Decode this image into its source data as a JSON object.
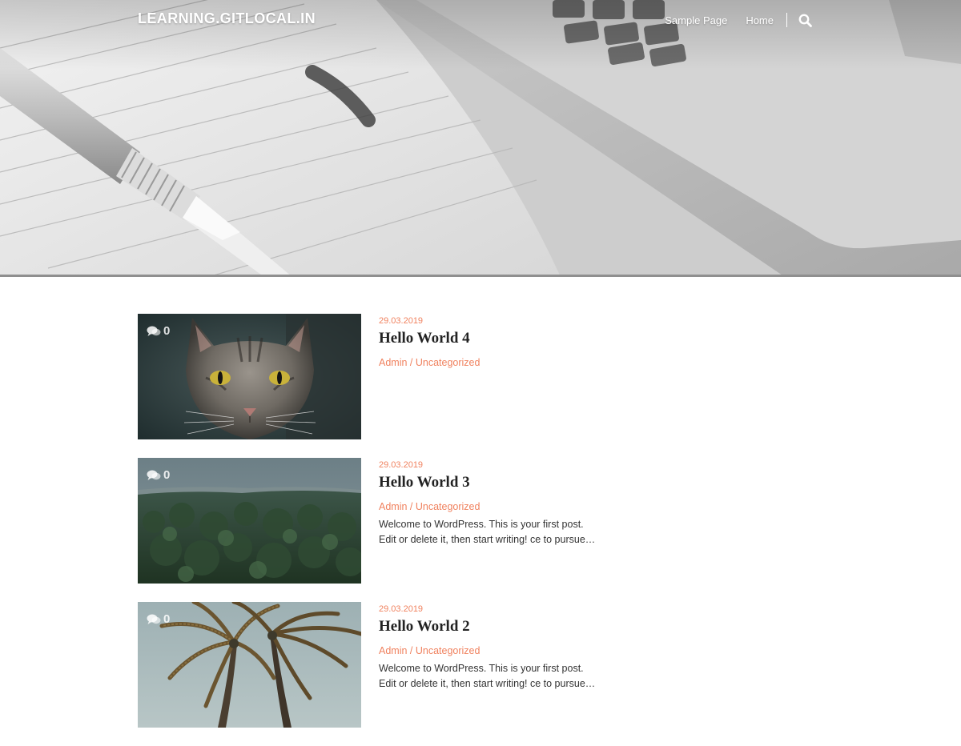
{
  "site": {
    "title": "LEARNING.GITLOCAL.IN"
  },
  "nav": {
    "items": [
      {
        "label": "Sample Page"
      },
      {
        "label": "Home"
      }
    ],
    "search_icon": "search-icon"
  },
  "colors": {
    "accent": "#f0825f",
    "title_text": "#222222",
    "body_text": "#333333"
  },
  "posts": [
    {
      "date": "29.03.2019",
      "title": "Hello World 4",
      "author": "Admin",
      "separator": " / ",
      "category": "Uncategorized",
      "excerpt": "",
      "comments": "0",
      "thumbnail": "cat"
    },
    {
      "date": "29.03.2019",
      "title": "Hello World 3",
      "author": "Admin",
      "separator": " / ",
      "category": "Uncategorized",
      "excerpt": "Welcome to WordPress. This is your first post. Edit or delete it, then start writing! ce to pursue…",
      "comments": "0",
      "thumbnail": "forest"
    },
    {
      "date": "29.03.2019",
      "title": "Hello World 2",
      "author": "Admin",
      "separator": " / ",
      "category": "Uncategorized",
      "excerpt": "Welcome to WordPress. This is your first post. Edit or delete it, then start writing! ce to pursue…",
      "comments": "0",
      "thumbnail": "palm-trees"
    }
  ]
}
